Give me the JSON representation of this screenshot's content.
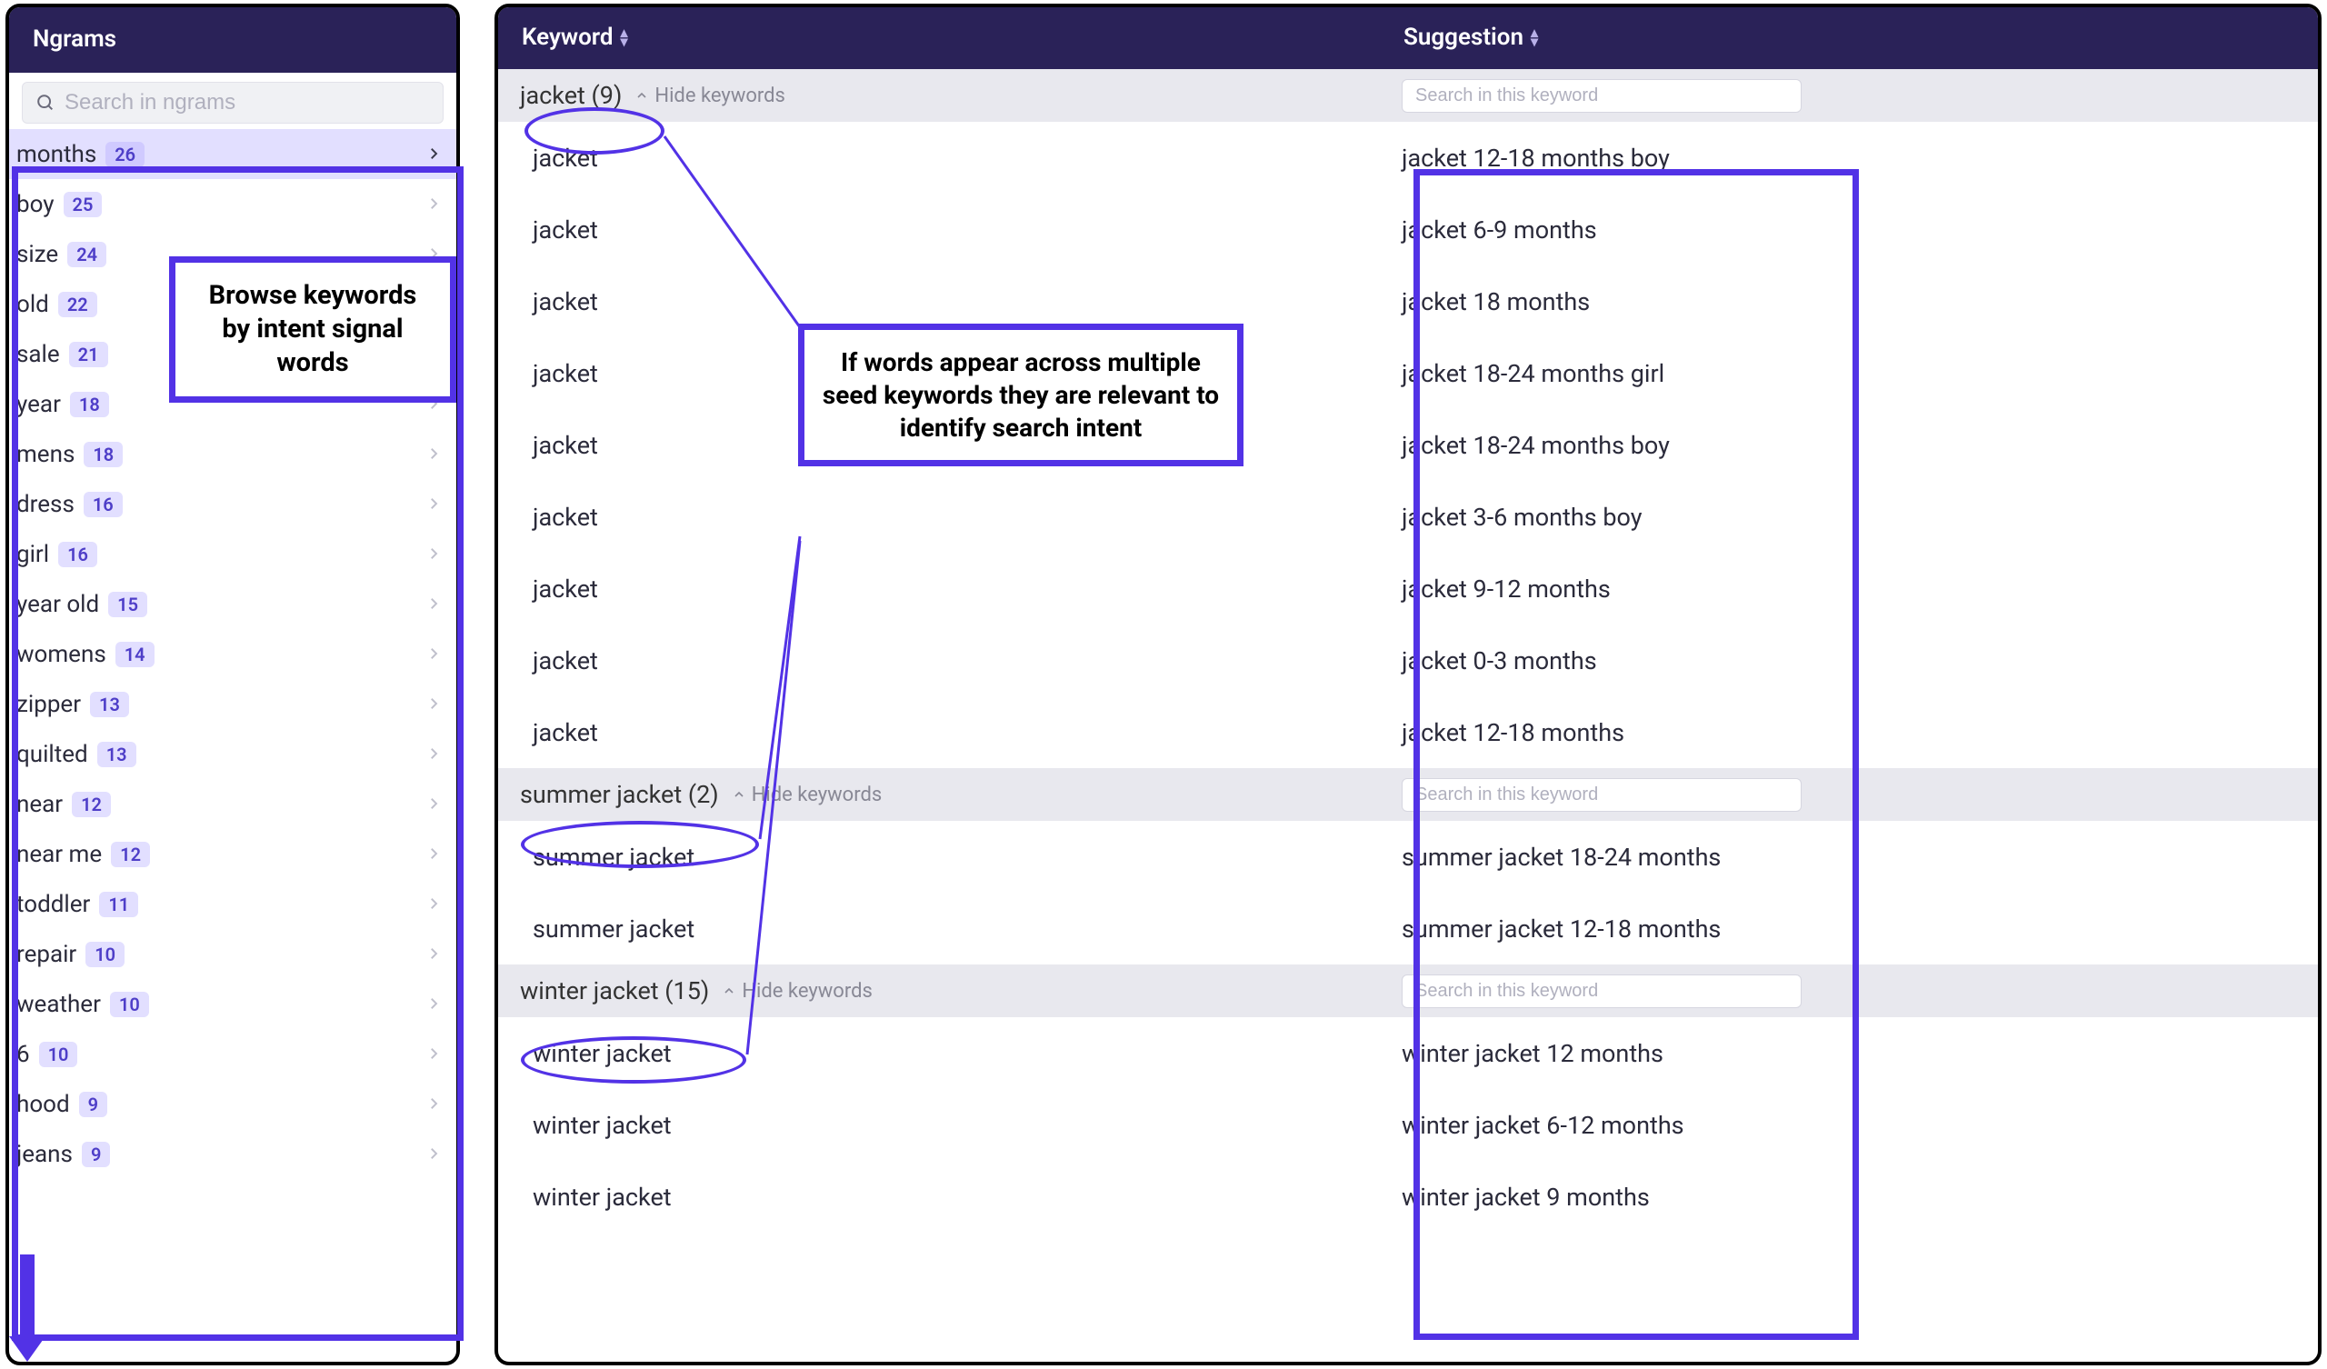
{
  "sidebar": {
    "title": "Ngrams",
    "search_placeholder": "Search in ngrams",
    "items": [
      {
        "label": "months",
        "count": "26",
        "active": true,
        "chev": true
      },
      {
        "label": "boy",
        "count": "25",
        "active": false,
        "chev": true
      },
      {
        "label": "size",
        "count": "24",
        "active": false,
        "chev": true
      },
      {
        "label": "old",
        "count": "22",
        "active": false,
        "chev": true
      },
      {
        "label": "sale",
        "count": "21",
        "active": false,
        "chev": true
      },
      {
        "label": "year",
        "count": "18",
        "active": false,
        "chev": true
      },
      {
        "label": "mens",
        "count": "18",
        "active": false,
        "chev": true
      },
      {
        "label": "dress",
        "count": "16",
        "active": false,
        "chev": true
      },
      {
        "label": "girl",
        "count": "16",
        "active": false,
        "chev": true
      },
      {
        "label": "year old",
        "count": "15",
        "active": false,
        "chev": true
      },
      {
        "label": "womens",
        "count": "14",
        "active": false,
        "chev": true
      },
      {
        "label": "zipper",
        "count": "13",
        "active": false,
        "chev": true
      },
      {
        "label": "quilted",
        "count": "13",
        "active": false,
        "chev": true
      },
      {
        "label": "near",
        "count": "12",
        "active": false,
        "chev": true
      },
      {
        "label": "near me",
        "count": "12",
        "active": false,
        "chev": true
      },
      {
        "label": "toddler",
        "count": "11",
        "active": false,
        "chev": true
      },
      {
        "label": "repair",
        "count": "10",
        "active": false,
        "chev": true
      },
      {
        "label": "weather",
        "count": "10",
        "active": false,
        "chev": true
      },
      {
        "label": "6",
        "count": "10",
        "active": false,
        "chev": true
      },
      {
        "label": "hood",
        "count": "9",
        "active": false,
        "chev": true
      },
      {
        "label": "jeans",
        "count": "9",
        "active": false,
        "chev": true
      }
    ]
  },
  "main": {
    "col_keyword": "Keyword",
    "col_suggestion": "Suggestion",
    "hide_keywords_label": "Hide keywords",
    "inline_search_placeholder": "Search in this keyword",
    "groups": [
      {
        "label": "jacket (9)",
        "rows": [
          {
            "kw": "jacket",
            "sg": "jacket 12-18 months boy"
          },
          {
            "kw": "jacket",
            "sg": "jacket 6-9 months"
          },
          {
            "kw": "jacket",
            "sg": "jacket 18 months"
          },
          {
            "kw": "jacket",
            "sg": "jacket 18-24 months girl"
          },
          {
            "kw": "jacket",
            "sg": "jacket 18-24 months boy"
          },
          {
            "kw": "jacket",
            "sg": "jacket 3-6 months boy"
          },
          {
            "kw": "jacket",
            "sg": "jacket 9-12 months"
          },
          {
            "kw": "jacket",
            "sg": "jacket 0-3 months"
          },
          {
            "kw": "jacket",
            "sg": "jacket 12-18 months"
          }
        ]
      },
      {
        "label": "summer jacket (2)",
        "rows": [
          {
            "kw": "summer jacket",
            "sg": "summer jacket 18-24 months"
          },
          {
            "kw": "summer jacket",
            "sg": "summer jacket 12-18 months"
          }
        ]
      },
      {
        "label": "winter jacket (15)",
        "rows": [
          {
            "kw": "winter jacket",
            "sg": "winter jacket 12 months"
          },
          {
            "kw": "winter jacket",
            "sg": "winter jacket 6-12 months"
          },
          {
            "kw": "winter jacket",
            "sg": "winter jacket 9 months"
          }
        ]
      }
    ]
  },
  "annotations": {
    "left_text": "Browse keywords by intent signal words",
    "center_text": "If words appear across multiple seed keywords they are relevant to identify search intent"
  }
}
